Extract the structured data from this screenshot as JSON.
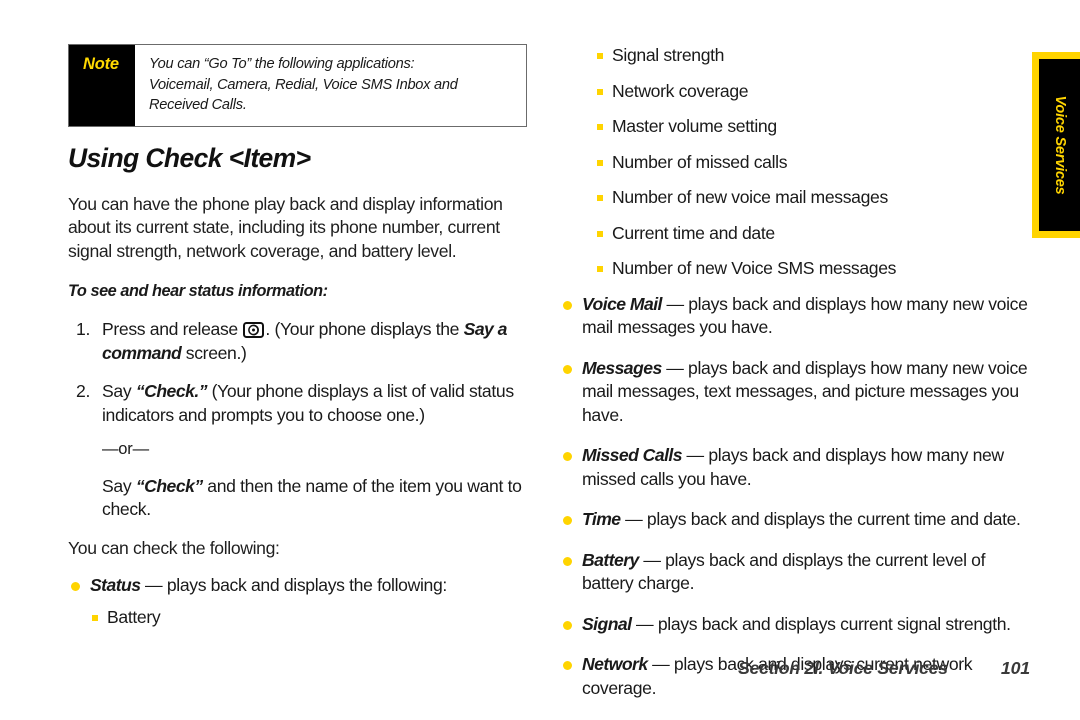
{
  "note": {
    "label": "Note",
    "lines": [
      "You can “Go To” the following applications:",
      "Voicemail, Camera, Redial, Voice SMS Inbox and",
      "Received Calls."
    ]
  },
  "heading": "Using Check <Item>",
  "intro_paragraph": "You can have the phone play back and display information about its current state, including its phone number, current signal strength, network coverage, and battery level.",
  "procedure_heading": "To see and hear status information:",
  "steps": [
    {
      "number": "1.",
      "text_before_icon": "Press and release ",
      "icon": "voice-command-key-icon",
      "text_after_icon": ". (Your phone displays the ",
      "emphasis": "Say a command",
      "text_tail": " screen.)"
    },
    {
      "number": "2.",
      "text_before_quote": "Say ",
      "quote": "“Check.”",
      "text_after_quote": " (Your phone displays a list of valid status indicators and prompts you to choose one.)",
      "or_divider": "—or—",
      "alt_before_quote": "Say ",
      "alt_quote": "“Check”",
      "alt_after_quote": " and then the name of the item you want to check."
    }
  ],
  "check_lead_in": "You can check the following:",
  "status_bullet": {
    "term": "Status",
    "dash": "—",
    "text": " plays back and displays the following:",
    "subitems": [
      "Battery",
      "Signal strength",
      "Network coverage",
      "Master volume setting",
      "Number of missed calls",
      "Number of new voice mail messages",
      "Current time and date",
      "Number of new Voice SMS messages"
    ]
  },
  "check_items": [
    {
      "term": "Voice Mail",
      "dash": "—",
      "text": " plays back and displays how many new voice mail messages you have."
    },
    {
      "term": "Messages",
      "dash": "—",
      "text": " plays back and displays how many new voice mail messages, text messages, and picture messages you have."
    },
    {
      "term": "Missed Calls",
      "dash": "—",
      "text": " plays back and displays how many new missed calls you have."
    },
    {
      "term": "Time",
      "dash": "—",
      "text": " plays back and displays the current time and date."
    },
    {
      "term": "Battery",
      "dash": "—",
      "text": " plays back and displays the current level of battery charge."
    },
    {
      "term": "Signal",
      "dash": "—",
      "text": " plays back and displays current signal strength."
    },
    {
      "term": "Network",
      "dash": "—",
      "text": " plays back and displays current network coverage."
    }
  ],
  "side_tab": {
    "label": "Voice Services"
  },
  "footer": {
    "section": "Section 2I. Voice Services",
    "page": "101"
  },
  "colors": {
    "accent_yellow": "#ffd400",
    "note_label_yellow": "#ffd900",
    "note_bg_black": "#000000",
    "text": "#1a1a1a",
    "footer_text": "#3a3a3a"
  }
}
